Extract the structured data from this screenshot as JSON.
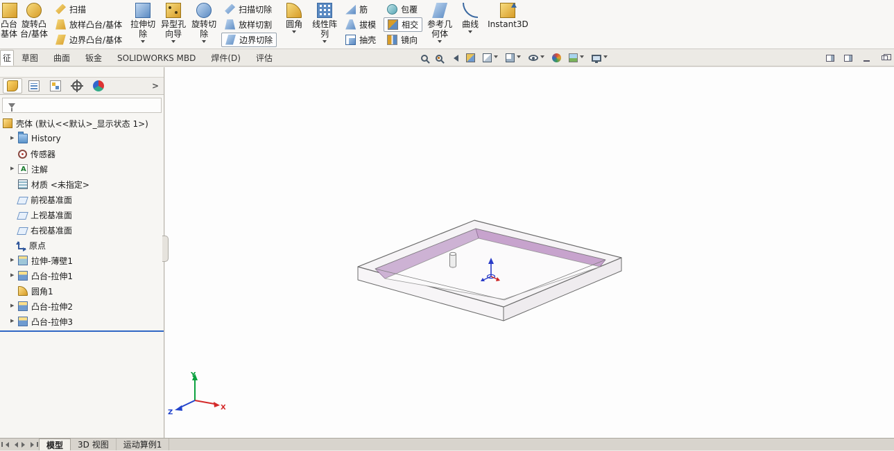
{
  "ribbon": {
    "boss_base_l1": "凸台",
    "boss_base_l2": "基体",
    "revolve_l1": "旋转凸",
    "revolve_l2": "台/基体",
    "sweep": "扫描",
    "loft": "放样凸台/基体",
    "boundary": "边界凸台/基体",
    "extrude_cut_l1": "拉伸切",
    "extrude_cut_l2": "除",
    "hole_l1": "异型孔",
    "hole_l2": "向导",
    "revolve_cut_l1": "旋转切",
    "revolve_cut_l2": "除",
    "sweep_cut": "扫描切除",
    "loft_cut": "放样切割",
    "boundary_cut": "边界切除",
    "fillet": "圆角",
    "pattern_l1": "线性阵",
    "pattern_l2": "列",
    "rib": "筋",
    "draft": "拔模",
    "shell": "抽壳",
    "wrap": "包覆",
    "intersect": "相交",
    "mirror": "镜向",
    "refgeo_l1": "参考几",
    "refgeo_l2": "何体",
    "curve": "曲线",
    "instant3d": "Instant3D"
  },
  "tabs": {
    "t0": "征",
    "t1": "草图",
    "t2": "曲面",
    "t3": "钣金",
    "t4": "SOLIDWORKS MBD",
    "t5": "焊件(D)",
    "t6": "评估"
  },
  "tree": {
    "items": [
      {
        "label": "壳体 (默认<<默认>_显示状态 1>)"
      },
      {
        "label": "History"
      },
      {
        "label": "传感器"
      },
      {
        "label": "注解"
      },
      {
        "label": "材质 <未指定>"
      },
      {
        "label": "前视基准面"
      },
      {
        "label": "上视基准面"
      },
      {
        "label": "右视基准面"
      },
      {
        "label": "原点"
      },
      {
        "label": "拉伸-薄壁1"
      },
      {
        "label": "凸台-拉伸1"
      },
      {
        "label": "圆角1"
      },
      {
        "label": "凸台-拉伸2"
      },
      {
        "label": "凸台-拉伸3"
      }
    ]
  },
  "viewport": {
    "triad": {
      "x": "X",
      "y": "Y",
      "z": "Z"
    }
  },
  "bottom": {
    "tabs": [
      "模型",
      "3D 视图",
      "运动算例1"
    ]
  },
  "colors": {
    "wall_left": "#cdb2d4",
    "wall_right": "#c7a3cd",
    "rollback": "#2f66c4"
  }
}
